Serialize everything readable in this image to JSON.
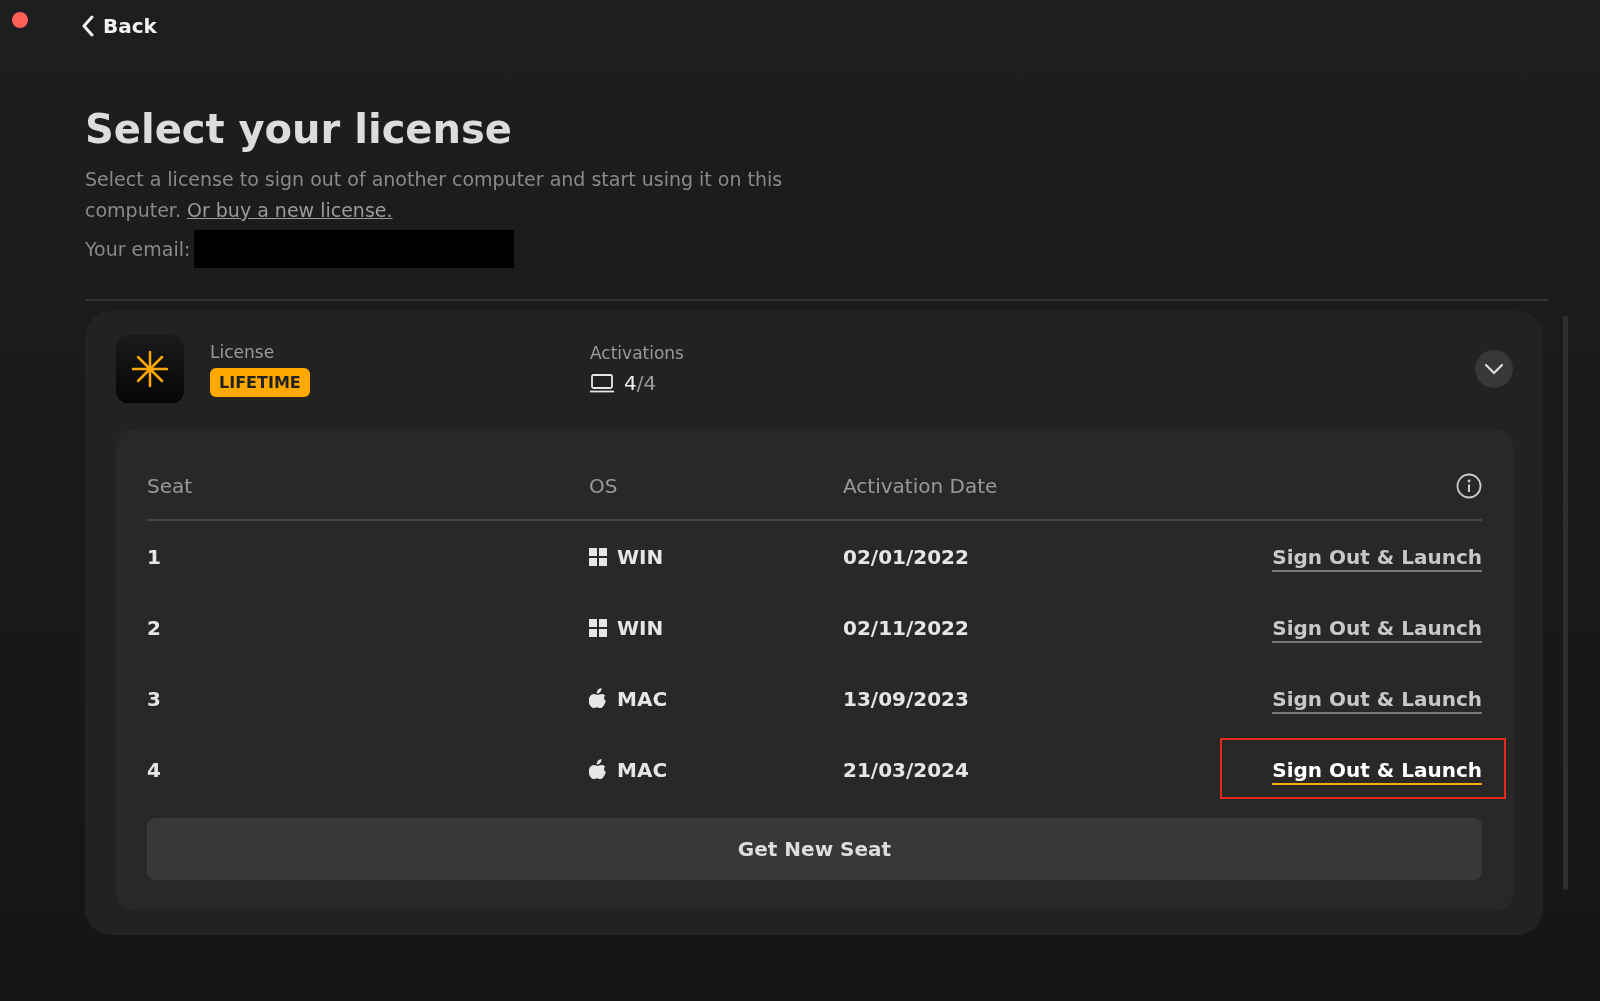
{
  "back": {
    "label": "Back"
  },
  "title": "Select your license",
  "description": "Select a license to sign out of another computer and start using it on this computer.",
  "buy_link": "Or buy a new license.",
  "email_label": "Your email:",
  "license": {
    "label": "License",
    "badge": "LIFETIME",
    "activations_label": "Activations",
    "activations_used": "4",
    "activations_total": "/4",
    "expanded": true
  },
  "table": {
    "columns": [
      "Seat",
      "OS",
      "Activation Date"
    ],
    "rows": [
      {
        "seat": "1",
        "os": "WIN",
        "kind": "win",
        "date": "02/01/2022",
        "action": "Sign Out & Launch",
        "selected": false
      },
      {
        "seat": "2",
        "os": "WIN",
        "kind": "win",
        "date": "02/11/2022",
        "action": "Sign Out & Launch",
        "selected": false
      },
      {
        "seat": "3",
        "os": "MAC",
        "kind": "mac",
        "date": "13/09/2023",
        "action": "Sign Out & Launch",
        "selected": false
      },
      {
        "seat": "4",
        "os": "MAC",
        "kind": "mac",
        "date": "21/03/2024",
        "action": "Sign Out & Launch",
        "selected": true
      }
    ]
  },
  "new_seat_button": "Get New Seat"
}
